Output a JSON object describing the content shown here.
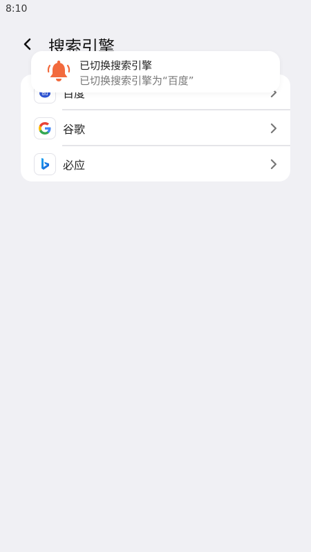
{
  "status_bar": {
    "time": "8:10"
  },
  "header": {
    "title": "搜索引擎",
    "back_icon": "chevron-left-icon"
  },
  "engines": [
    {
      "label": "百度",
      "icon": "baidu-logo-icon"
    },
    {
      "label": "谷歌",
      "icon": "google-logo-icon"
    },
    {
      "label": "必应",
      "icon": "bing-logo-icon"
    }
  ],
  "toast": {
    "title": "已切换搜索引擎",
    "message": "已切换搜索引擎为“百度”",
    "icon": "bell-icon",
    "accent": "#f26a3d"
  },
  "colors": {
    "background": "#f0f0f4",
    "card": "#ffffff"
  }
}
